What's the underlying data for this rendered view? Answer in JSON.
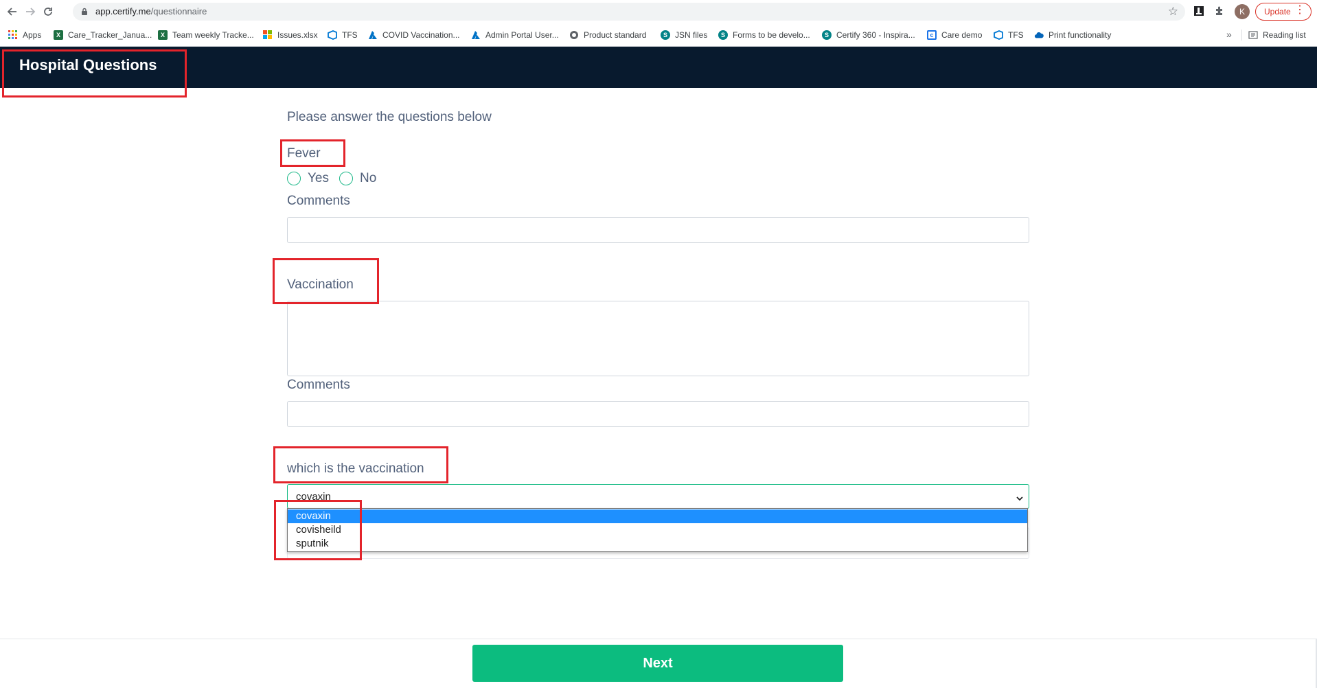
{
  "browser": {
    "url_host": "app.certify.me",
    "url_path": "/questionnaire",
    "profile_initial": "K",
    "update_label": "Update"
  },
  "bookmarks": {
    "items": [
      {
        "label": "Apps",
        "icon": "apps-grid-icon"
      },
      {
        "label": "Care_Tracker_Janua...",
        "icon": "excel-icon"
      },
      {
        "label": "Team weekly Tracke...",
        "icon": "excel-icon"
      },
      {
        "label": "Issues.xlsx",
        "icon": "office-icon"
      },
      {
        "label": "TFS",
        "icon": "azure-devops-icon"
      },
      {
        "label": "COVID Vaccination...",
        "icon": "azure-icon"
      },
      {
        "label": "Admin Portal User...",
        "icon": "azure-icon"
      },
      {
        "label": "Product standard",
        "icon": "web-icon"
      },
      {
        "label": "JSN files",
        "icon": "sharepoint-icon"
      },
      {
        "label": "Forms to be develo...",
        "icon": "sharepoint-icon"
      },
      {
        "label": "Certify 360 - Inspira...",
        "icon": "sharepoint-icon"
      },
      {
        "label": "Care demo",
        "icon": "app-icon"
      },
      {
        "label": "TFS",
        "icon": "azure-devops-icon"
      },
      {
        "label": "Print functionality",
        "icon": "onedrive-icon"
      }
    ],
    "more": "»",
    "reading_list": "Reading list"
  },
  "header": {
    "title": "Hospital Questions"
  },
  "form": {
    "intro": "Please answer the questions below",
    "fever": {
      "label": "Fever",
      "option_yes": "Yes",
      "option_no": "No",
      "comments_label": "Comments",
      "comments_value": ""
    },
    "vaccination": {
      "label": "Vaccination",
      "value": "",
      "comments_label": "Comments",
      "comments_value": ""
    },
    "which_vaccination": {
      "label": "which is the vaccination",
      "selected": "covaxin",
      "options": [
        "covaxin",
        "covisheild",
        "sputnik"
      ]
    }
  },
  "footer": {
    "next_label": "Next"
  },
  "colors": {
    "header_bg": "#081a2e",
    "accent_green": "#0cbc7f",
    "highlight_red": "#e3242b",
    "option_selected_bg": "#1e90ff"
  }
}
